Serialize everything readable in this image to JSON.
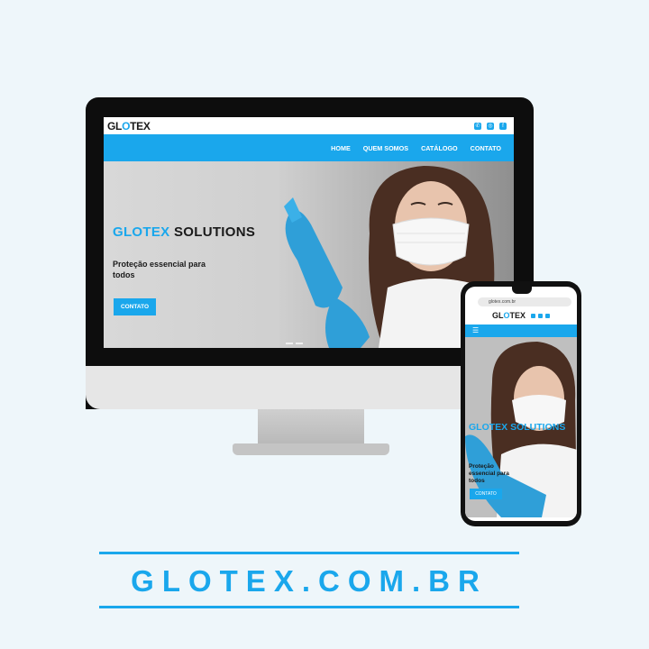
{
  "brand": {
    "logo_left": "GL",
    "logo_o": "O",
    "logo_right": "TEX",
    "accent_color": "#1aa7ec"
  },
  "desktop": {
    "social_icons": [
      "whatsapp-icon",
      "instagram-icon",
      "facebook-icon"
    ],
    "nav": [
      "HOME",
      "QUEM SOMOS",
      "CATÁLOGO",
      "CONTATO"
    ],
    "hero": {
      "title_accent": "GLOTEX",
      "title_rest": "SOLUTIONS",
      "subtitle": "Proteção essencial para todos",
      "button": "CONTATO"
    }
  },
  "mobile": {
    "url": "glotex.com.br",
    "hero": {
      "title": "GLOTEX SOLUTIONS",
      "subtitle": "Proteção essencial para todos",
      "button": "CONTATO"
    }
  },
  "banner": {
    "domain": "GLOTEX.COM.BR"
  }
}
